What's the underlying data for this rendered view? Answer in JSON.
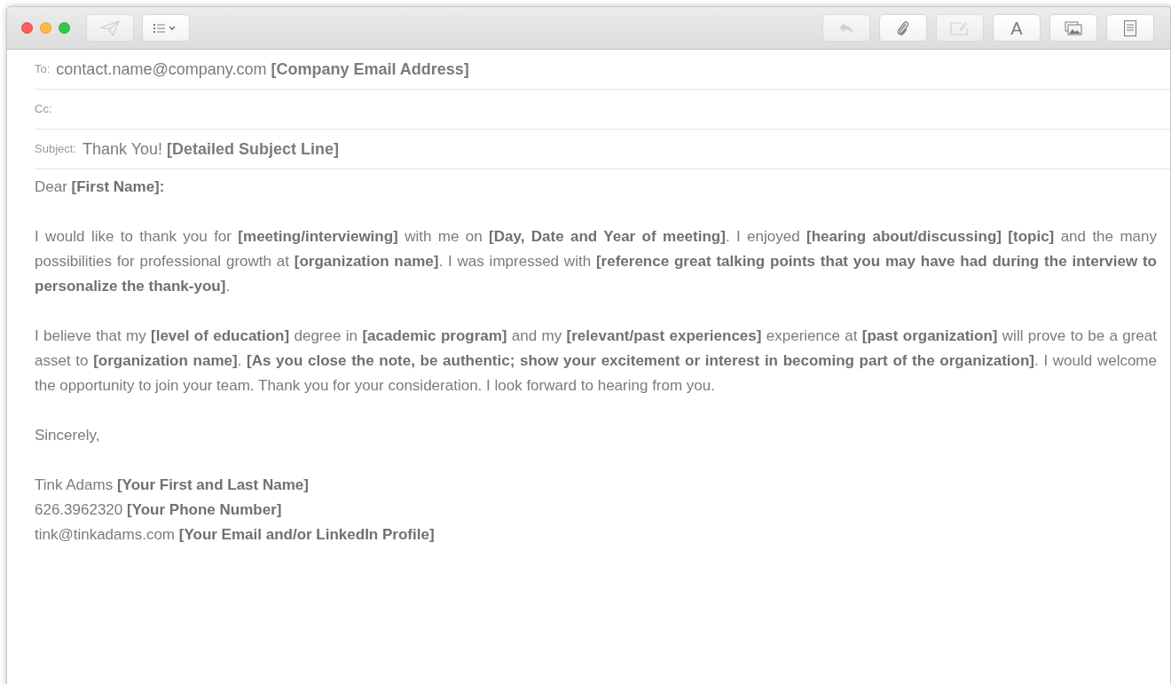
{
  "toolbar": {
    "left": [
      {
        "kind": "send",
        "disabled": true
      },
      {
        "kind": "list",
        "disabled": false
      }
    ],
    "right": [
      {
        "kind": "reply",
        "disabled": true
      },
      {
        "kind": "attach",
        "disabled": false
      },
      {
        "kind": "markup",
        "disabled": true
      },
      {
        "kind": "fonts",
        "label": "A",
        "disabled": false
      },
      {
        "kind": "photo",
        "disabled": false
      },
      {
        "kind": "stationery",
        "disabled": false
      }
    ]
  },
  "header": [
    {
      "label": "To:",
      "value": "contact.name@company.com **[Company Email Address]**"
    },
    {
      "label": "Cc:"
    },
    {
      "label": "Subject:",
      "value": "Thank You! **[Detailed Subject Line]**"
    }
  ],
  "body": {
    "greeting": "Dear **[First Name]:**",
    "paragraphs": [
      "I would like to thank you for **[meeting/interviewing]** with me on **[Day, Date and Year of meeting]**. I enjoyed **[hearing about/discussing] [topic]** and the many possibilities for professional growth at **[organization name]**. I was impressed with **[reference great talking points that you may have had during the interview to personalize the thank-you]**.",
      "I believe that my **[level of education]** degree in **[academic program]** and my **[relevant/past experiences]** experience at **[past organization]** will prove to be a great asset to **[organization name]**. **[As you close the note, be authentic; show your excitement or interest in becoming part of the organization]**. I would welcome the opportunity to join your team. Thank you for your consideration. I look forward to hearing from you."
    ],
    "closing": "Sincerely,",
    "signature": [
      "Tink Adams **[Your First and Last Name]**",
      "626.3962320 **[Your Phone Number]**",
      "tink@tinkadams.com **[Your Email and/or LinkedIn Profile]**"
    ]
  }
}
